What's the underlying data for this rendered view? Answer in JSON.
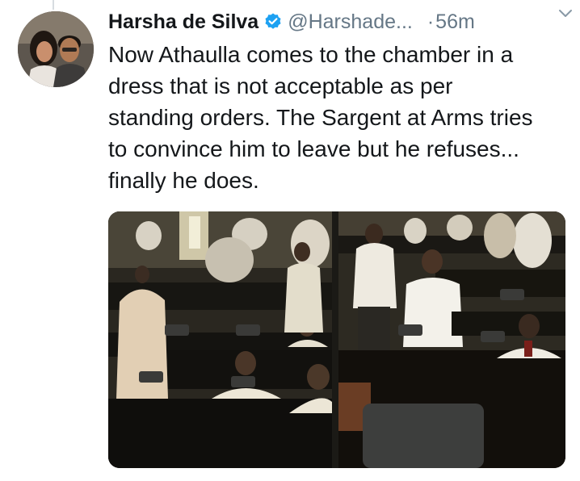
{
  "tweet": {
    "author_name": "Harsha de Silva",
    "handle": "@Harshade...",
    "separator": "·",
    "time": "56m",
    "text": "Now Athaulla comes to the chamber in a\ndress that is not acceptable as per\nstanding orders. The Sargent at Arms tries\nto convince him to leave but he refuses...\nfinally he does."
  },
  "icons": {
    "verified": "verified-badge-icon",
    "menu": "chevron-down-icon"
  },
  "colors": {
    "verified": "#1da1f2",
    "secondary_text": "#657786",
    "primary_text": "#14171a"
  }
}
